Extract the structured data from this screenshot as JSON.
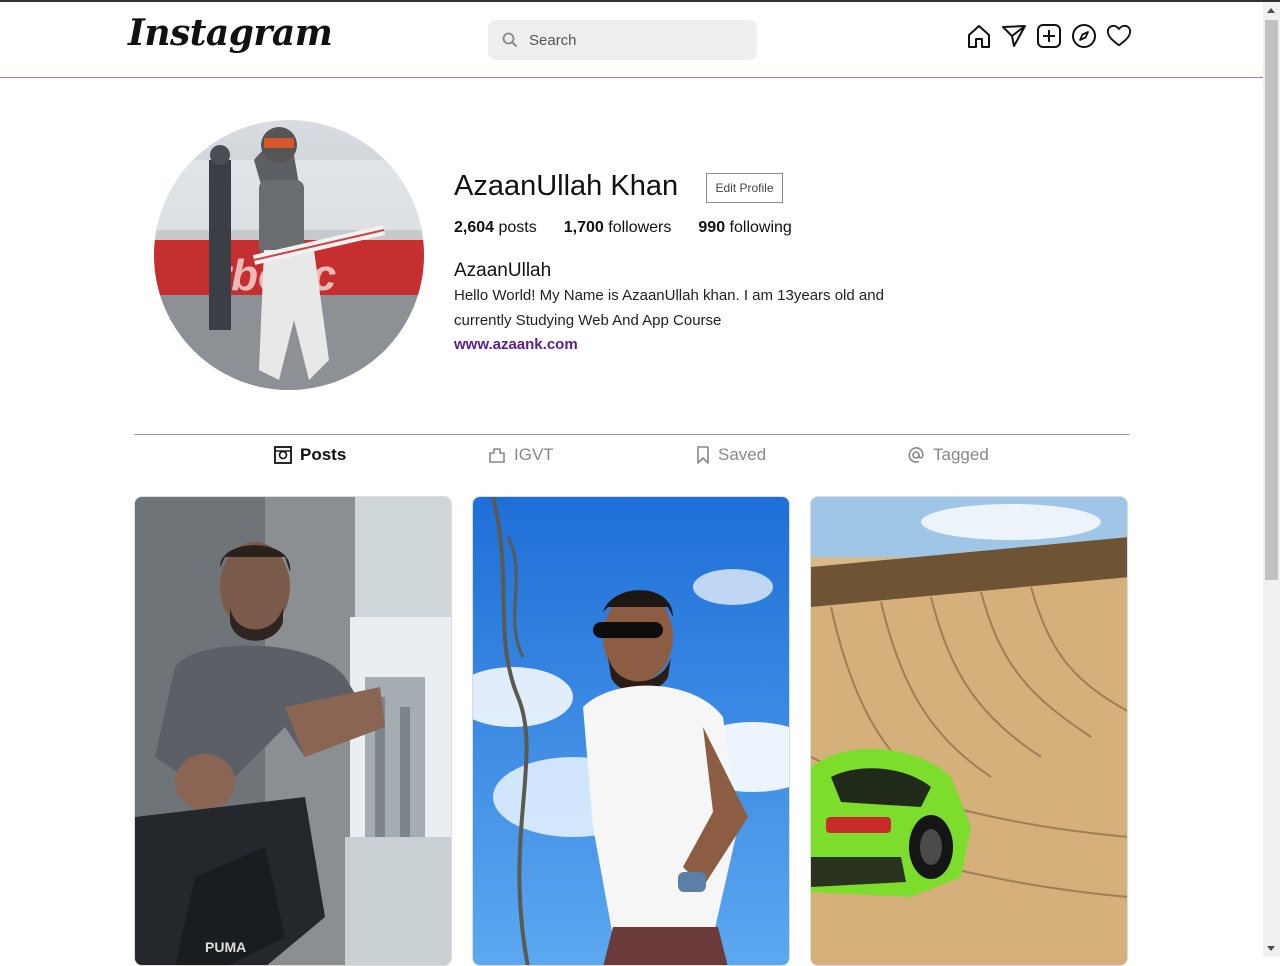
{
  "header": {
    "logo": "Instagram",
    "search_placeholder": "Search",
    "icons": [
      "home-icon",
      "send-icon",
      "new-post-icon",
      "explore-icon",
      "heart-icon"
    ]
  },
  "profile": {
    "name": "AzaanUllah Khan",
    "edit_label": "Edit Profile",
    "stats": [
      {
        "count": "2,604",
        "label": "posts"
      },
      {
        "count": "1,700",
        "label": "followers"
      },
      {
        "count": "990",
        "label": "following"
      }
    ],
    "username": "AzaanUllah",
    "bio": "Hello World! My Name is AzaanUllah khan. I am 13years old and currently Studying Web And App Course",
    "website": "www.azaank.com"
  },
  "tabs": [
    {
      "label": "Posts",
      "icon": "posts-icon",
      "active": true
    },
    {
      "label": "IGVT",
      "icon": "igtv-icon",
      "active": false
    },
    {
      "label": "Saved",
      "icon": "bookmark-icon",
      "active": false
    },
    {
      "label": "Tagged",
      "icon": "at-icon",
      "active": false
    }
  ],
  "colors": {
    "accent_link": "#5a1e8e",
    "header_border": "#b07ac0",
    "search_bg": "#efefef"
  }
}
